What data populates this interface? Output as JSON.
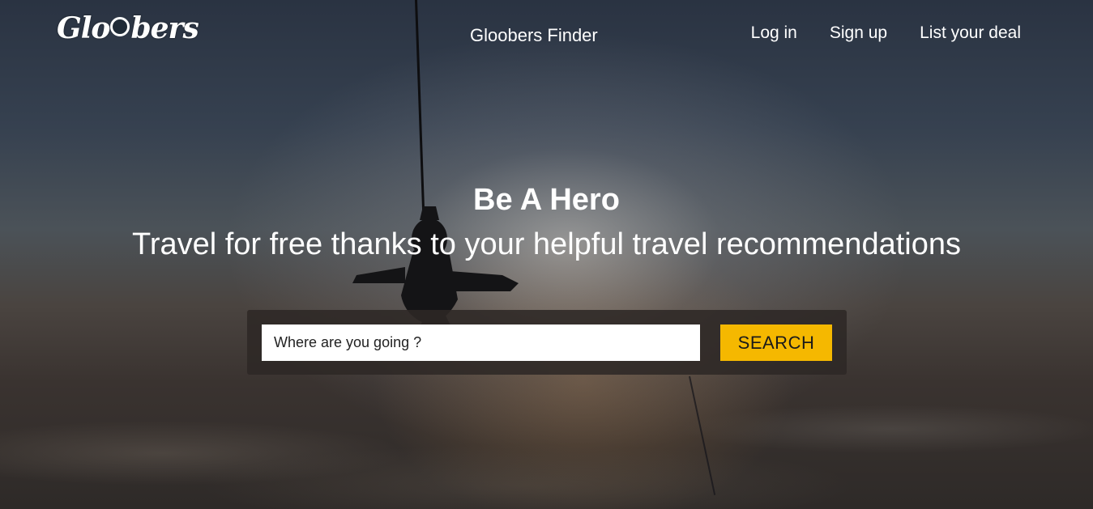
{
  "brand": {
    "logo_text_before": "Glo",
    "logo_text_after": "bers",
    "logo_icon": "globe-icon"
  },
  "nav": {
    "center_link": "Gloobers Finder",
    "login": "Log in",
    "signup": "Sign up",
    "list_deal": "List your deal"
  },
  "hero": {
    "headline": "Be A Hero",
    "subline": "Travel for free thanks to your helpful travel recommendations"
  },
  "search": {
    "placeholder": "Where are you going ?",
    "value": "",
    "button_label": "SEARCH"
  },
  "colors": {
    "search_button": "#f5b800",
    "text": "#ffffff"
  }
}
